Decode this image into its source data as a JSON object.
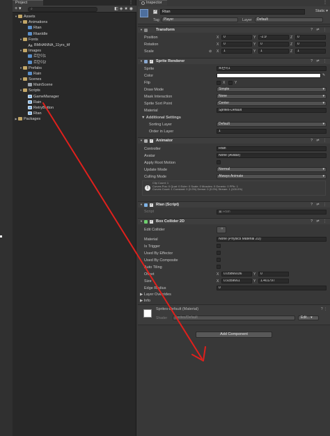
{
  "project": {
    "tab": "Project",
    "search_placeholder": "",
    "tree": [
      {
        "label": "Assets",
        "depth": 0,
        "type": "folder",
        "expanded": true
      },
      {
        "label": "Animations",
        "depth": 1,
        "type": "folder",
        "expanded": true
      },
      {
        "label": "Rtan",
        "depth": 2,
        "type": "asset"
      },
      {
        "label": "RtanIdle",
        "depth": 2,
        "type": "asset"
      },
      {
        "label": "Fonts",
        "depth": 1,
        "type": "folder",
        "expanded": true
      },
      {
        "label": "BMHANNA_11yrs_ttf",
        "depth": 2,
        "type": "font"
      },
      {
        "label": "Images",
        "depth": 1,
        "type": "folder",
        "expanded": true
      },
      {
        "label": "르탄이1",
        "depth": 2,
        "type": "asset"
      },
      {
        "label": "르탄이2",
        "depth": 2,
        "type": "asset"
      },
      {
        "label": "Prefabs",
        "depth": 1,
        "type": "folder",
        "expanded": true
      },
      {
        "label": "Rain",
        "depth": 2,
        "type": "asset"
      },
      {
        "label": "Scenes",
        "depth": 1,
        "type": "folder",
        "expanded": true
      },
      {
        "label": "MainScene",
        "depth": 2,
        "type": "scene"
      },
      {
        "label": "Scripts",
        "depth": 1,
        "type": "folder",
        "expanded": true
      },
      {
        "label": "GameManager",
        "depth": 2,
        "type": "script"
      },
      {
        "label": "Rain",
        "depth": 2,
        "type": "script"
      },
      {
        "label": "RetryButton",
        "depth": 2,
        "type": "script"
      },
      {
        "label": "Rtan",
        "depth": 2,
        "type": "script"
      },
      {
        "label": "Packages",
        "depth": 0,
        "type": "folder",
        "expanded": false
      }
    ]
  },
  "inspector": {
    "tab": "Inspector",
    "object_name": "Rtan",
    "static_label": "Static",
    "tag_label": "Tag",
    "tag_value": "Player",
    "layer_label": "Layer",
    "layer_value": "Default",
    "transform": {
      "title": "Transform",
      "position_label": "Position",
      "position": [
        "0",
        "-2.9",
        "0"
      ],
      "rotation_label": "Rotation",
      "rotation": [
        "0",
        "0",
        "0"
      ],
      "scale_label": "Scale",
      "scale": [
        "1",
        "1",
        "1"
      ]
    },
    "sprite_renderer": {
      "title": "Sprite Renderer",
      "sprite_label": "Sprite",
      "sprite_value": "르탄이1",
      "color_label": "Color",
      "flip_label": "Flip",
      "flip_x": "X",
      "flip_y": "Y",
      "draw_mode_label": "Draw Mode",
      "draw_mode": "Simple",
      "mask_label": "Mask Interaction",
      "mask": "None",
      "sort_point_label": "Sprite Sort Point",
      "sort_point": "Center",
      "material_label": "Material",
      "material": "Sprites-Default",
      "additional_label": "Additional Settings",
      "sorting_layer_label": "Sorting Layer",
      "sorting_layer": "Default",
      "order_label": "Order in Layer",
      "order": "1"
    },
    "animator": {
      "title": "Animator",
      "controller_label": "Controller",
      "controller": "Rtan",
      "avatar_label": "Avatar",
      "avatar": "None (Avatar)",
      "root_motion_label": "Apply Root Motion",
      "update_mode_label": "Update Mode",
      "update_mode": "Normal",
      "culling_label": "Culling Mode",
      "culling": "Always Animate",
      "info_lines": [
        "Clip Count: 1",
        "Curves Pos: 0 Quat: 0 Euler: 0 Scale: 0 Muscles: 0 Generic: 0 PPtr: 1",
        "Curves Count: 1 Constant: 0 (0.0%) Dense: 0 (0.0%) Stream: 1 (100.0%)"
      ]
    },
    "rtan_script": {
      "title": "Rtan (Script)",
      "script_label": "Script",
      "script": "Rtan"
    },
    "box_collider": {
      "title": "Box Collider 2D",
      "edit_collider_label": "Edit Collider",
      "material_label": "Material",
      "material": "None (Physics Material 2D)",
      "is_trigger_label": "Is Trigger",
      "used_by_effector_label": "Used By Effector",
      "used_by_composite_label": "Used By Composite",
      "auto_tiling_label": "Auto Tiling",
      "offset_label": "Offset",
      "offset": [
        "0.05866036",
        "0"
      ],
      "size_label": "Size",
      "size": [
        "0.9359661",
        "1.401797"
      ],
      "edge_radius_label": "Edge Radius",
      "edge_radius": "0",
      "layer_overrides_label": "Layer Overrides",
      "info_label": "Info"
    },
    "material_preview": {
      "name": "Sprites-Default (Material)",
      "shader_label": "Shader",
      "shader": "Sprites/Default",
      "edit_label": "Edit..."
    },
    "add_component": "Add Component"
  },
  "colors": {
    "panel_bg": "#383838",
    "project_bg": "#282828",
    "field_bg": "#2a2a2a",
    "arrow_red": "#e0201c",
    "folder": "#c2a667"
  }
}
